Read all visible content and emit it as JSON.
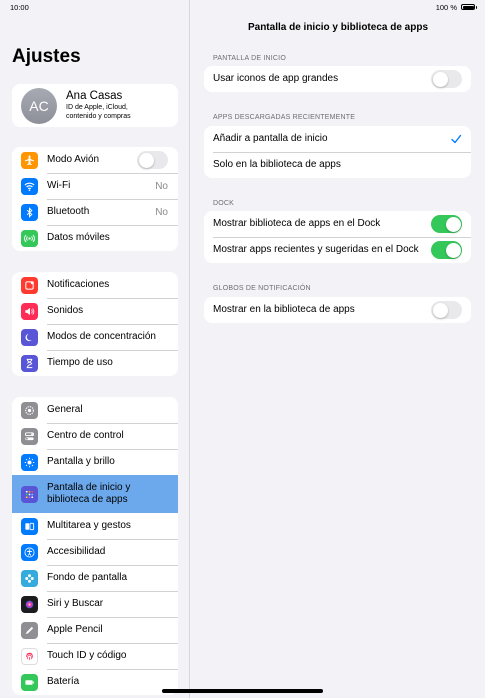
{
  "status": {
    "time": "10:00",
    "battery": "100 %"
  },
  "sidebar": {
    "title": "Ajustes",
    "profile": {
      "initials": "AC",
      "name": "Ana Casas",
      "subtitle_line1": "ID de Apple, iCloud,",
      "subtitle_line2": "contenido y compras"
    },
    "group1": [
      {
        "label": "Modo Avión",
        "icon": "airplane-icon",
        "color": "#ff9500"
      },
      {
        "label": "Wi-Fi",
        "value": "No",
        "icon": "wifi-icon",
        "color": "#007aff"
      },
      {
        "label": "Bluetooth",
        "value": "No",
        "icon": "bluetooth-icon",
        "color": "#007aff"
      },
      {
        "label": "Datos móviles",
        "icon": "antenna-icon",
        "color": "#34c759"
      }
    ],
    "group2": [
      {
        "label": "Notificaciones",
        "icon": "bell-icon",
        "color": "#ff3b30"
      },
      {
        "label": "Sonidos",
        "icon": "speaker-icon",
        "color": "#ff2d55"
      },
      {
        "label": "Modos de concentración",
        "icon": "moon-icon",
        "color": "#5856d6"
      },
      {
        "label": "Tiempo de uso",
        "icon": "hourglass-icon",
        "color": "#5856d6"
      }
    ],
    "group3": [
      {
        "label": "General",
        "icon": "gear-icon",
        "color": "#8e8e93"
      },
      {
        "label": "Centro de control",
        "icon": "switches-icon",
        "color": "#8e8e93"
      },
      {
        "label": "Pantalla y brillo",
        "icon": "sun-icon",
        "color": "#007aff"
      },
      {
        "label_line1": "Pantalla de inicio y",
        "label_line2": "biblioteca de apps",
        "icon": "apps-grid-icon",
        "color": "#5856d6"
      },
      {
        "label": "Multitarea y gestos",
        "icon": "multitask-icon",
        "color": "#007aff"
      },
      {
        "label": "Accesibilidad",
        "icon": "accessibility-icon",
        "color": "#007aff"
      },
      {
        "label": "Fondo de pantalla",
        "icon": "flower-icon",
        "color": "#35aadc"
      },
      {
        "label": "Siri y Buscar",
        "icon": "siri-icon",
        "color": "#1c1c1e"
      },
      {
        "label": "Apple Pencil",
        "icon": "pencil-icon",
        "color": "#8e8e93"
      },
      {
        "label": "Touch ID y código",
        "icon": "fingerprint-icon",
        "color": "#ffffff"
      },
      {
        "label": "Batería",
        "icon": "battery-icon",
        "color": "#34c759"
      }
    ]
  },
  "detail": {
    "title": "Pantalla de inicio y biblioteca de apps",
    "sections": [
      {
        "header": "PANTALLA DE INICIO",
        "rows": [
          {
            "label": "Usar iconos de app grandes",
            "toggle": "off"
          }
        ]
      },
      {
        "header": "APPS DESCARGADAS RECIENTEMENTE",
        "rows": [
          {
            "label": "Añadir a pantalla de inicio",
            "checked": true
          },
          {
            "label": "Solo en la biblioteca de apps",
            "checked": false
          }
        ]
      },
      {
        "header": "DOCK",
        "rows": [
          {
            "label": "Mostrar biblioteca de apps en el Dock",
            "toggle": "on"
          },
          {
            "label": "Mostrar apps recientes y sugeridas en el Dock",
            "toggle": "on"
          }
        ]
      },
      {
        "header": "GLOBOS DE NOTIFICACIÓN",
        "rows": [
          {
            "label": "Mostrar en la biblioteca de apps",
            "toggle": "off"
          }
        ]
      }
    ],
    "accent": "#007aff"
  }
}
